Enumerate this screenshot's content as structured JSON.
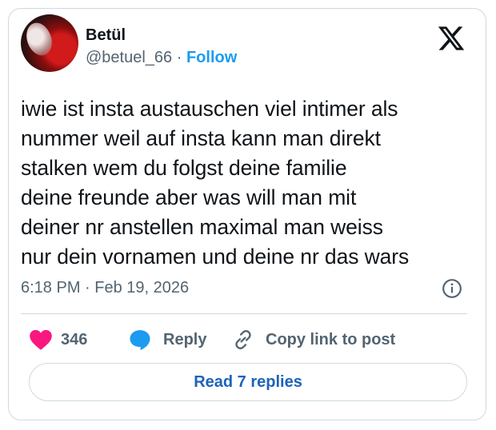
{
  "author": {
    "name": "Betül",
    "handle": "@betuel_66",
    "separator": " · ",
    "follow_label": "Follow"
  },
  "tweet": {
    "text": "iwie ist insta austauschen viel intimer als\nnummer weil auf insta kann man direkt\nstalken wem du folgst deine familie\ndeine freunde aber was will man mit\ndeiner nr anstellen maximal man weiss\nnur dein vornamen und deine nr das wars",
    "time": "6:18 PM",
    "separator": " · ",
    "date": "Feb 19, 2026"
  },
  "actions": {
    "like_count": "346",
    "reply_label": "Reply",
    "copy_label": "Copy link to post"
  },
  "read_replies_label": "Read 7 replies",
  "icons": {
    "brand": "x-logo-icon",
    "info": "info-icon",
    "like": "heart-icon",
    "reply": "speech-bubble-icon",
    "copy": "link-icon"
  },
  "colors": {
    "accent": "#1d9bf0",
    "heart": "#f91880",
    "text": "#0f1419",
    "muted": "#536471",
    "border": "#cfd9de"
  }
}
